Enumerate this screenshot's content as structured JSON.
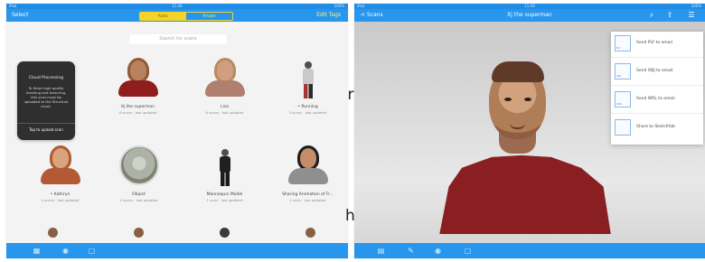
{
  "left_screen": {
    "status": {
      "carrier": "iPad",
      "time": "11:46",
      "battery": "100%"
    },
    "nav": {
      "left": "Select",
      "segments": [
        "Public",
        "Private"
      ],
      "right": "Edit Tags"
    },
    "search": {
      "placeholder": "Search for scans"
    },
    "popup": {
      "title": "Cloud Processing",
      "text": "To finish high quality meshing and texturing, this scan must be uploaded to the Structure cloud.",
      "button": "Tap to upload scan"
    },
    "tiles": [
      {
        "label": "itj the superman",
        "sub": "8 scans · last updated"
      },
      {
        "label": "Lisa",
        "sub": "6 scans · last updated"
      },
      {
        "label": "• Running",
        "sub": "3 scans · last updated"
      },
      {
        "label": "• Kathryn",
        "sub": "4 scans · last updated"
      },
      {
        "label": "Object",
        "sub": "2 scans · last updated"
      },
      {
        "label": "Mannequin Model",
        "sub": "1 scan · last updated"
      },
      {
        "label": "Sharing Animation of Fr...",
        "sub": "1 scan · last updated"
      }
    ],
    "tab_icons": [
      "grid-icon",
      "camera-icon",
      "copy-icon"
    ]
  },
  "right_screen": {
    "status": {
      "carrier": "iPad",
      "time": "11:49",
      "battery": "100%"
    },
    "nav": {
      "back": "< Scans",
      "title": "itj the superman"
    },
    "share_menu": [
      {
        "label": "Send PLY to email",
        "thumb": "PLY"
      },
      {
        "label": "Send OBJ to email",
        "thumb": "OBJ"
      },
      {
        "label": "Send WRL to email",
        "thumb": "WRL"
      },
      {
        "label": "Share to Sketchfab",
        "thumb": ""
      }
    ],
    "top_icons": [
      "mic-icon",
      "share-icon",
      "more-icon"
    ],
    "tab_icons": [
      "menu-icon",
      "pen-icon",
      "camera-icon",
      "copy-icon"
    ]
  },
  "between_panes": {
    "letters": [
      "r",
      "h"
    ]
  }
}
